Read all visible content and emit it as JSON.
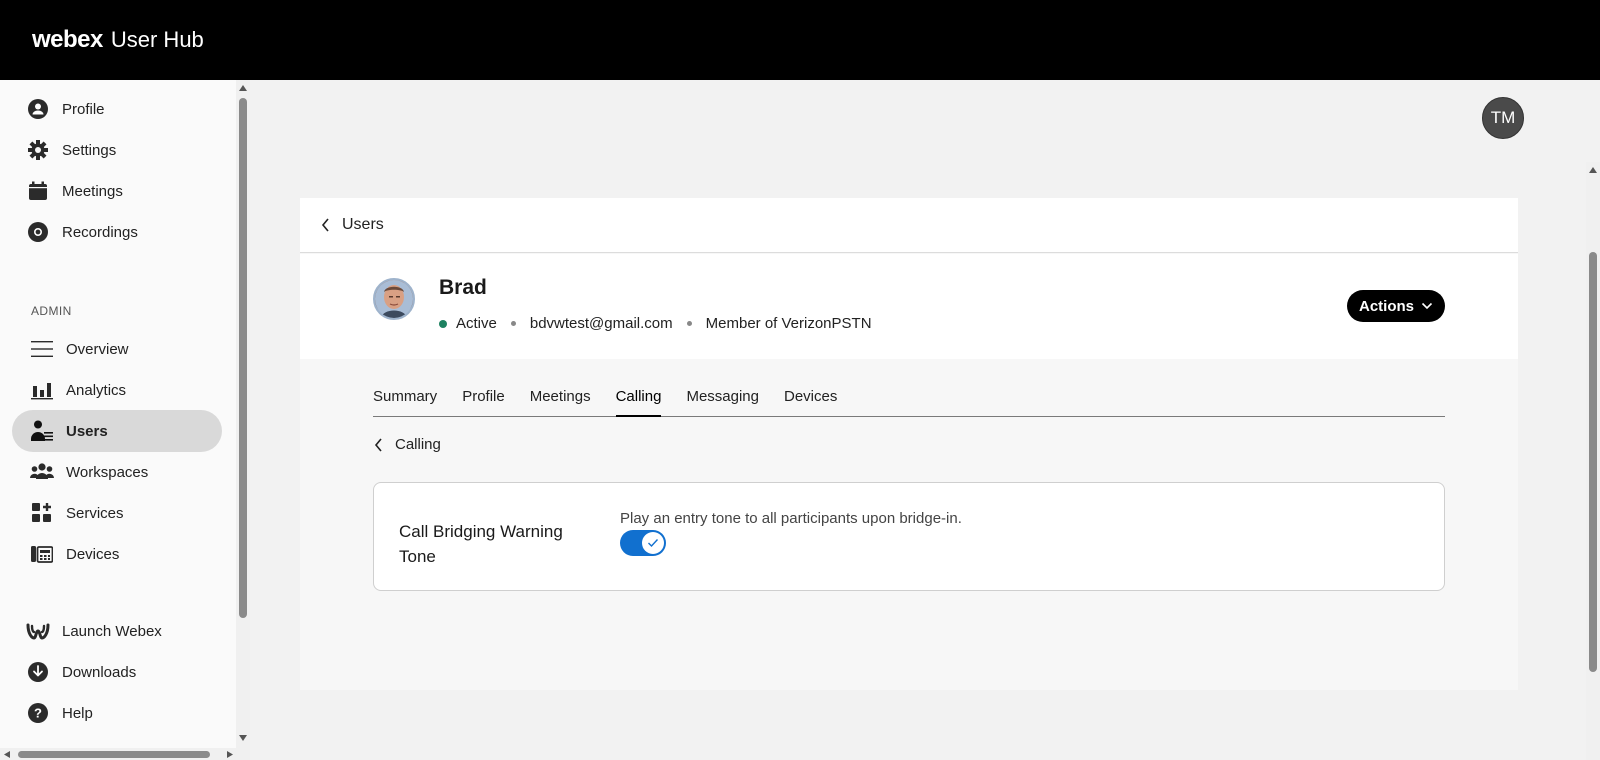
{
  "header": {
    "brand": "webex",
    "brand_sub": "User Hub"
  },
  "sidebar": {
    "items": [
      {
        "label": "Profile",
        "icon": "person-icon"
      },
      {
        "label": "Settings",
        "icon": "gear-icon"
      },
      {
        "label": "Meetings",
        "icon": "calendar-icon"
      },
      {
        "label": "Recordings",
        "icon": "recording-icon"
      }
    ],
    "admin_label": "ADMIN",
    "admin_items": [
      {
        "label": "Overview",
        "icon": "menu-icon"
      },
      {
        "label": "Analytics",
        "icon": "bar-chart-icon"
      },
      {
        "label": "Users",
        "icon": "user-list-icon",
        "active": true
      },
      {
        "label": "Workspaces",
        "icon": "group-icon"
      },
      {
        "label": "Services",
        "icon": "grid-icon"
      },
      {
        "label": "Devices",
        "icon": "device-icon"
      }
    ],
    "bottom_items": [
      {
        "label": "Launch Webex",
        "icon": "webex-logo-icon"
      },
      {
        "label": "Downloads",
        "icon": "download-icon"
      },
      {
        "label": "Help",
        "icon": "help-icon"
      }
    ]
  },
  "account": {
    "initials": "TM"
  },
  "breadcrumb": {
    "back_label": "Users"
  },
  "user": {
    "name": "Brad",
    "status": "Active",
    "email": "bdvwtest@gmail.com",
    "membership": "Member of VerizonPSTN",
    "actions_label": "Actions"
  },
  "tabs": [
    "Summary",
    "Profile",
    "Meetings",
    "Calling",
    "Messaging",
    "Devices"
  ],
  "active_tab": "Calling",
  "sub_back_label": "Calling",
  "setting": {
    "title": "Call Bridging Warning Tone",
    "description": "Play an entry tone to all participants upon bridge-in.",
    "enabled": true
  },
  "colors": {
    "accent": "#1170cf",
    "status_active": "#1d8160",
    "topbar": "#000000"
  }
}
